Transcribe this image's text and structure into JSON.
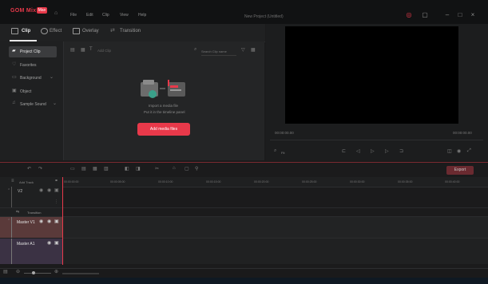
{
  "app": {
    "logo": "GOM Mix",
    "logo_badge": "Max",
    "window_title": "New Project (Untitled)"
  },
  "menu": [
    "File",
    "Edit",
    "Clip",
    "View",
    "Help"
  ],
  "tabs": [
    {
      "label": "Clip",
      "active": true
    },
    {
      "label": "Effect"
    },
    {
      "label": "Overlay"
    },
    {
      "label": "Transition"
    }
  ],
  "sidebar": {
    "items": [
      {
        "label": "Project Clip",
        "active": true
      },
      {
        "label": "Favorites"
      },
      {
        "label": "Background",
        "expandable": true
      },
      {
        "label": "Object"
      },
      {
        "label": "Sample Sound",
        "expandable": true
      }
    ]
  },
  "content": {
    "add_clip_label": "Add Clip",
    "search_placeholder": "Search Clip name",
    "empty_line1": "Import a media file",
    "empty_line2": "Put it in the timeline panel",
    "add_button": "Add media files"
  },
  "preview": {
    "time_current": "00:00:00.00",
    "time_total": "00:00:00.00",
    "zoom": "Fit"
  },
  "toolbar": {
    "export": "Export"
  },
  "timeline": {
    "add_track": "Add Track",
    "ruler": [
      "00:00:00:00",
      "00:00:05:00",
      "00:00:10:00",
      "00:00:15:00",
      "00:00:20:00",
      "00:00:25:00",
      "00:00:30:00",
      "00:00:35:00",
      "00:00:40:00"
    ],
    "tracks": [
      {
        "label": "V2"
      },
      {
        "label": "Transition"
      },
      {
        "label": "Master V1"
      },
      {
        "label": "Master A1"
      }
    ]
  },
  "colors": {
    "accent": "#e8394a",
    "panel": "#242526",
    "background": "#1b1b1c"
  }
}
